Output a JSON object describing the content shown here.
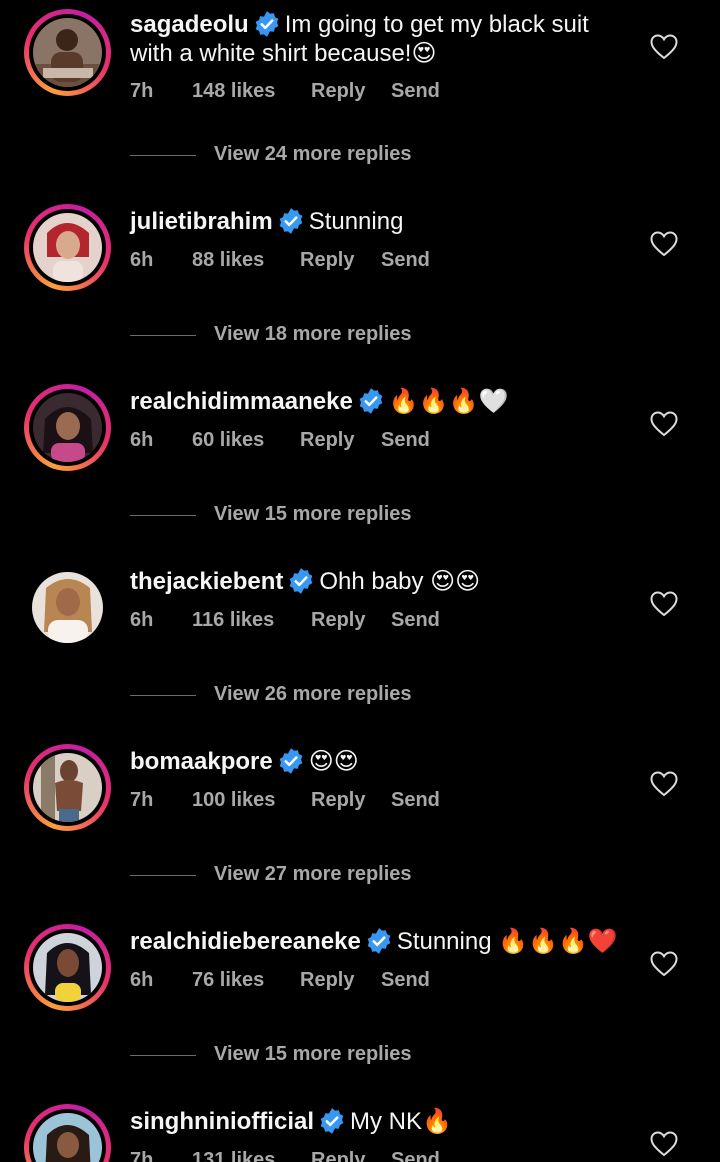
{
  "comments": [
    {
      "username": "sagadeolu",
      "verified": true,
      "text_line1": "Im going to get my black suit",
      "text_line2": "with a white shirt because!",
      "emojis": "😍",
      "time": "7h",
      "likes": "148 likes",
      "reply": "Reply",
      "send": "Send",
      "more_replies": "View 24 more replies",
      "avatar_icon": "person-avatar"
    },
    {
      "username": "julietibrahim",
      "verified": true,
      "text": "Stunning",
      "emojis": "",
      "time": "6h",
      "likes": "88 likes",
      "reply": "Reply",
      "send": "Send",
      "more_replies": "View 18 more replies",
      "avatar_icon": "person-avatar"
    },
    {
      "username": "realchidimmaaneke",
      "verified": true,
      "text": "",
      "emojis": "🔥🔥🔥🤍",
      "time": "6h",
      "likes": "60 likes",
      "reply": "Reply",
      "send": "Send",
      "more_replies": "View 15 more replies",
      "avatar_icon": "person-avatar"
    },
    {
      "username": "thejackiebent",
      "verified": true,
      "text": "Ohh baby",
      "emojis": "😍😍",
      "time": "6h",
      "likes": "116 likes",
      "reply": "Reply",
      "send": "Send",
      "more_replies": "View 26 more replies",
      "avatar_icon": "person-avatar"
    },
    {
      "username": "bomaakpore",
      "verified": true,
      "text": "",
      "emojis": "😍😍",
      "time": "7h",
      "likes": "100 likes",
      "reply": "Reply",
      "send": "Send",
      "more_replies": "View 27 more replies",
      "avatar_icon": "person-avatar"
    },
    {
      "username": "realchidiebereaneke",
      "verified": true,
      "text": "Stunning",
      "emojis": "🔥🔥🔥❤️",
      "time": "6h",
      "likes": "76 likes",
      "reply": "Reply",
      "send": "Send",
      "more_replies": "View 15 more replies",
      "avatar_icon": "person-avatar"
    },
    {
      "username": "singhniniofficial",
      "verified": true,
      "text": "My NK",
      "emojis": "🔥",
      "time": "7h",
      "likes": "131 likes",
      "reply": "Reply",
      "send": "Send",
      "more_replies": "",
      "avatar_icon": "person-avatar"
    }
  ],
  "colors": {
    "background": "#000000",
    "text": "#f5f5f5",
    "meta": "#a8a8a8",
    "verified": "#3897f0",
    "story_ring_start": "#f9a13c",
    "story_ring_end": "#c21fa3"
  },
  "icons": {
    "like": "heart-outline-icon",
    "verified": "verified-badge-icon"
  }
}
